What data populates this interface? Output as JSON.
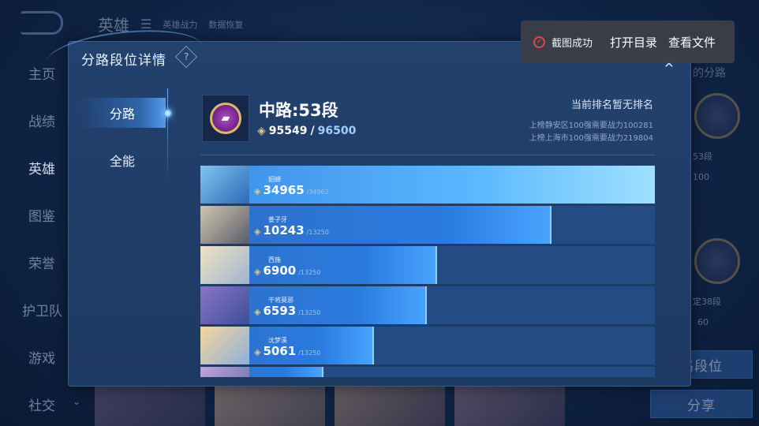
{
  "background": {
    "top_title": "英雄",
    "top_links": [
      "英雄战力",
      "数据恢复"
    ],
    "nav": [
      "主页",
      "战绩",
      "英雄",
      "图鉴",
      "荣誉",
      "护卫队",
      "游戏",
      "社交"
    ],
    "nav_active": "英雄",
    "right_subtitle": "的分路",
    "right_rank_1": "53段",
    "right_value_1": "100",
    "right_rank_2": "定38段",
    "right_value_2": "60",
    "right_button": "路段位",
    "share_button": "分享"
  },
  "panel": {
    "title": "分路段位详情",
    "help_icon": "?",
    "tabs": [
      {
        "label": "分路",
        "active": true
      },
      {
        "label": "全能",
        "active": false
      }
    ],
    "rank": {
      "title": "中路:53段",
      "power_current": "95549",
      "power_target": "96500",
      "status": "当前排名暂无排名",
      "lines": [
        "上榜静安区100强需要战力100281",
        "上榜上海市100强需要战力219804"
      ]
    },
    "heroes": [
      {
        "name": "貂蝉",
        "power": "34965",
        "max": "/34962",
        "fill": 1.0
      },
      {
        "name": "姜子牙",
        "power": "10243",
        "max": "/13250",
        "fill": 0.773
      },
      {
        "name": "西施",
        "power": "6900",
        "max": "/13250",
        "fill": 0.521
      },
      {
        "name": "干将莫邪",
        "power": "6593",
        "max": "/13250",
        "fill": 0.498
      },
      {
        "name": "沈梦溪",
        "power": "5061",
        "max": "/13250",
        "fill": 0.382
      },
      {
        "name": "",
        "power": "",
        "max": "",
        "fill": 0.27
      }
    ]
  },
  "toast": {
    "message": "截图成功",
    "open_dir": "打开目录",
    "view_file": "查看文件"
  }
}
